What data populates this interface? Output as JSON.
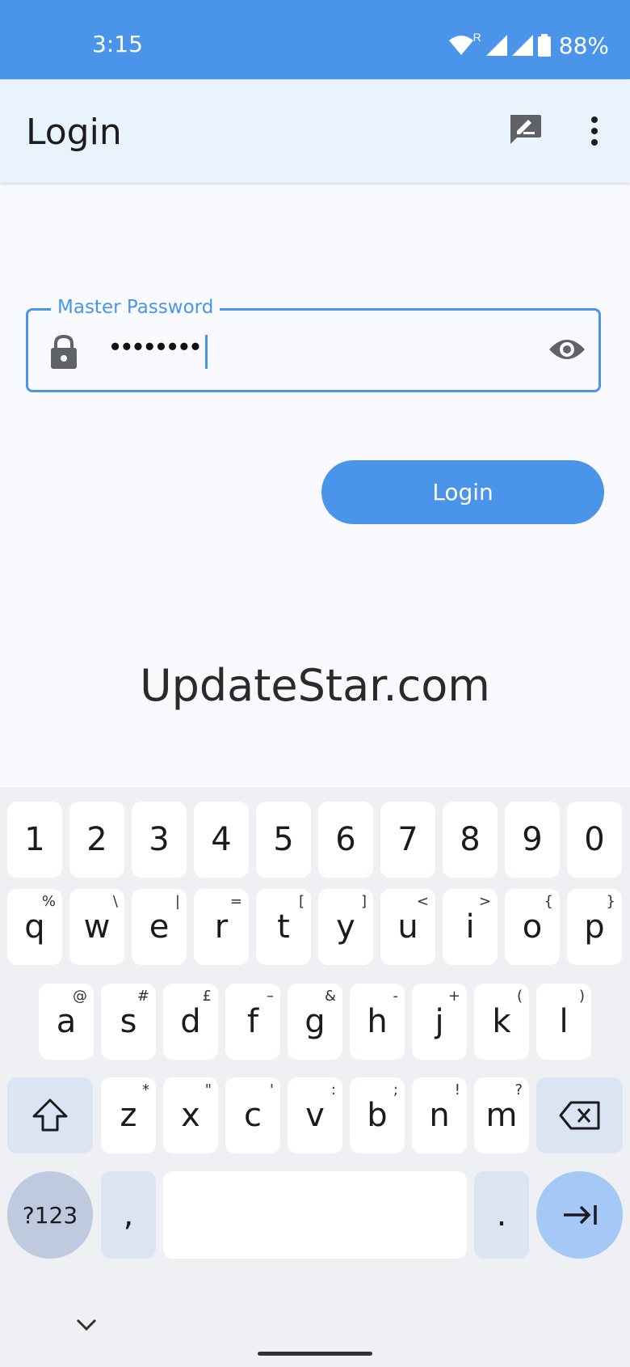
{
  "status_bar": {
    "time": "3:15",
    "battery": "88%",
    "roaming": "R"
  },
  "app_bar": {
    "title": "Login",
    "icons": [
      "feedback-icon",
      "more-vert-icon"
    ]
  },
  "password_field": {
    "label": "Master Password",
    "value": "••••••••"
  },
  "login_button": {
    "label": "Login"
  },
  "watermark": "UpdateStar.com",
  "keyboard": {
    "row1": [
      "1",
      "2",
      "3",
      "4",
      "5",
      "6",
      "7",
      "8",
      "9",
      "0"
    ],
    "row2": {
      "keys": [
        "q",
        "w",
        "e",
        "r",
        "t",
        "y",
        "u",
        "i",
        "o",
        "p"
      ],
      "hints": [
        "%",
        "\\",
        "|",
        "=",
        "[",
        "]",
        "<",
        ">",
        "{",
        "}"
      ]
    },
    "row3": {
      "keys": [
        "a",
        "s",
        "d",
        "f",
        "g",
        "h",
        "j",
        "k",
        "l"
      ],
      "hints": [
        "@",
        "#",
        "£",
        "–",
        "&",
        "-",
        "+",
        "(",
        ")"
      ]
    },
    "row4": {
      "keys": [
        "z",
        "x",
        "c",
        "v",
        "b",
        "n",
        "m"
      ],
      "hints": [
        "*",
        "\"",
        "'",
        ":",
        ";",
        "!",
        "?"
      ]
    },
    "symbols_label": "?123",
    "comma": ",",
    "period": "."
  },
  "colors": {
    "accent": "#4a94e9",
    "app_bar_bg": "#e9f3fd",
    "keyboard_bg": "#eef0f4"
  }
}
